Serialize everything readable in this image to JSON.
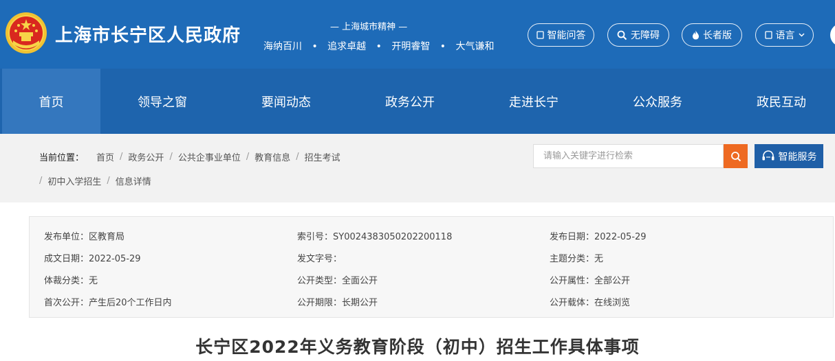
{
  "header": {
    "site_title": "上海市长宁区人民政府",
    "spirit_heading": "— 上海城市精神 —",
    "spirit_values": [
      "海纳百川",
      "追求卓越",
      "开明睿智",
      "大气谦和"
    ],
    "spirit_separator": "•",
    "buttons": {
      "qa": "智能问答",
      "accessibility": "无障碍",
      "elder": "长者版",
      "language": "语言"
    },
    "icons": {
      "emblem": "national-emblem-icon",
      "qa": "chat-icon",
      "accessibility": "search-icon",
      "elder": "flame-icon",
      "language": "globe-icon"
    }
  },
  "nav": {
    "items": [
      "首页",
      "领导之窗",
      "要闻动态",
      "政务公开",
      "走进长宁",
      "公众服务",
      "政民互动"
    ],
    "active_index": 0
  },
  "breadcrumb": {
    "label": "当前位置：",
    "separator": "/",
    "line1": [
      "首页",
      "政务公开",
      "公共企事业单位",
      "教育信息",
      "招生考试"
    ],
    "line2": [
      "初中入学招生",
      "信息详情"
    ]
  },
  "search": {
    "placeholder": "请输入关键字进行检索",
    "button_icon": "search-icon",
    "smart_service": "智能服务",
    "smart_icon": "headset-icon"
  },
  "metadata": {
    "publisher": "发布单位：区教育局",
    "index_no": "索引号：SY0024383050202200118",
    "publish_date": "发布日期：2022-05-29",
    "written_date": "成文日期：2022-05-29",
    "doc_no": "发文字号：",
    "topic": "主题分类：无",
    "genre": "体裁分类：无",
    "open_type": "公开类型：全面公开",
    "open_attr": "公开属性：全部公开",
    "first_open": "首次公开：产生后20个工作日内",
    "open_period": "公开期限：长期公开",
    "open_carrier": "公开载体：在线浏览"
  },
  "article": {
    "title": "长宁区2022年义务教育阶段（初中）招生工作具体事项"
  },
  "colors": {
    "header_blue": "#1e6bb8",
    "nav_blue": "#1e64ad",
    "nav_active": "#3477be",
    "search_orange": "#ee6a22",
    "smart_blue": "#1f5fa7"
  }
}
